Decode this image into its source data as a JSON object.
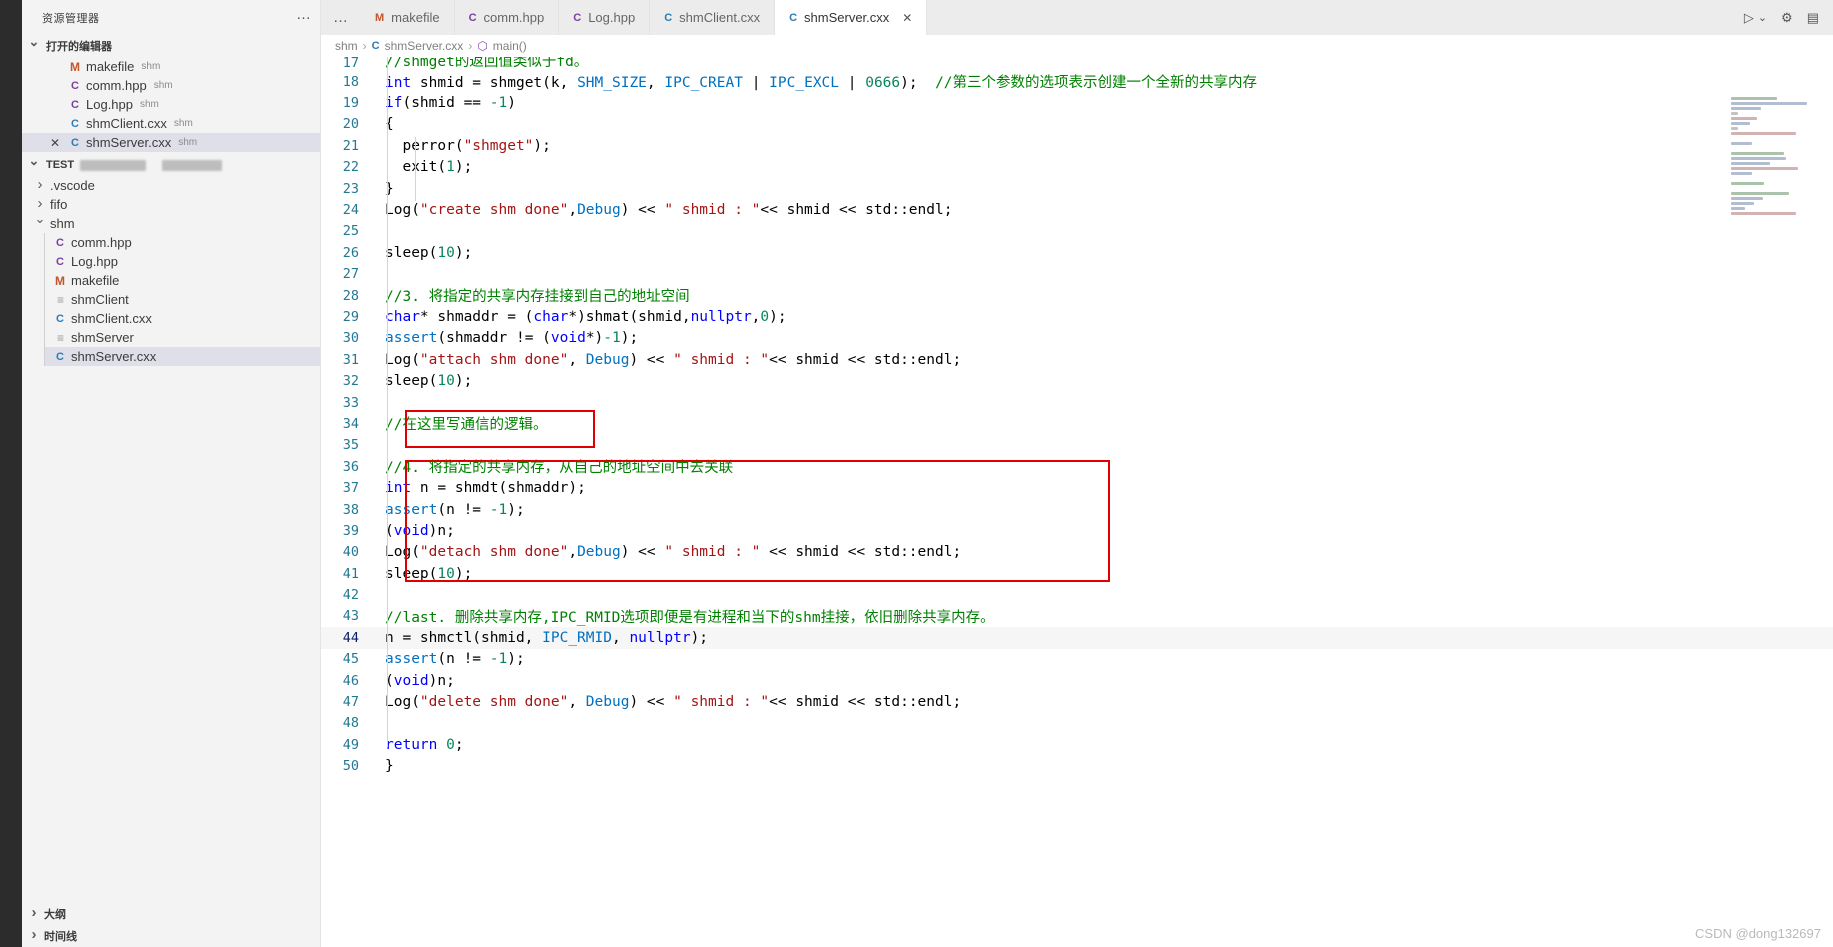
{
  "sidebar": {
    "title": "资源管理器",
    "more_label": "…",
    "open_editors": {
      "label": "打开的编辑器",
      "items": [
        {
          "name": "makefile",
          "desc": "shm",
          "icon": "makefile-icon",
          "icon_glyph": "M",
          "closable": false,
          "selected": false
        },
        {
          "name": "comm.hpp",
          "desc": "shm",
          "icon": "cpp-header-icon",
          "icon_glyph": "C",
          "closable": false,
          "selected": false
        },
        {
          "name": "Log.hpp",
          "desc": "shm",
          "icon": "cpp-header-icon",
          "icon_glyph": "C",
          "closable": false,
          "selected": false
        },
        {
          "name": "shmClient.cxx",
          "desc": "shm",
          "icon": "cpp-source-icon",
          "icon_glyph": "C",
          "closable": false,
          "selected": false
        },
        {
          "name": "shmServer.cxx",
          "desc": "shm",
          "icon": "cpp-source-icon",
          "icon_glyph": "C",
          "closable": true,
          "selected": true
        }
      ]
    },
    "workspace": {
      "label": "TEST",
      "folders": [
        {
          "name": ".vscode",
          "expanded": false
        },
        {
          "name": "fifo",
          "expanded": false
        },
        {
          "name": "shm",
          "expanded": true
        }
      ],
      "shm_files": [
        {
          "name": "comm.hpp",
          "icon_glyph": "C",
          "kind": "hpp"
        },
        {
          "name": "Log.hpp",
          "icon_glyph": "C",
          "kind": "hpp"
        },
        {
          "name": "makefile",
          "icon_glyph": "M",
          "kind": "make"
        },
        {
          "name": "shmClient",
          "icon_glyph": "≡",
          "kind": "bin"
        },
        {
          "name": "shmClient.cxx",
          "icon_glyph": "C",
          "kind": "cxx"
        },
        {
          "name": "shmServer",
          "icon_glyph": "≡",
          "kind": "bin"
        },
        {
          "name": "shmServer.cxx",
          "icon_glyph": "C",
          "kind": "cxx",
          "selected": true
        }
      ]
    },
    "outline_label": "大纲",
    "timeline_label": "时间线"
  },
  "tabs": [
    {
      "label": "makefile",
      "icon_glyph": "M",
      "kind": "make",
      "active": false,
      "closable": false
    },
    {
      "label": "comm.hpp",
      "icon_glyph": "C",
      "kind": "hpp",
      "active": false,
      "closable": false
    },
    {
      "label": "Log.hpp",
      "icon_glyph": "C",
      "kind": "hpp",
      "active": false,
      "closable": false
    },
    {
      "label": "shmClient.cxx",
      "icon_glyph": "C",
      "kind": "cxx",
      "active": false,
      "closable": false
    },
    {
      "label": "shmServer.cxx",
      "icon_glyph": "C",
      "kind": "cxx",
      "active": true,
      "closable": true
    }
  ],
  "tabbar_actions": {
    "run_label": "▷",
    "run_chevron": "⌄",
    "settings_label": "⚙",
    "layout_label": "▤"
  },
  "breadcrumb": {
    "folder": "shm",
    "file": "shmServer.cxx",
    "symbol": "main()",
    "separator": "›"
  },
  "editor": {
    "first_line": 17,
    "lines": [
      {
        "n": 17,
        "text": "//shmget的返回值类似于fd。",
        "clipped": true
      },
      {
        "n": 18,
        "text": "int shmid = shmget(k, SHM_SIZE, IPC_CREAT | IPC_EXCL | 0666);  //第三个参数的选项表示创建一个全新的共享内存"
      },
      {
        "n": 19,
        "text": "if(shmid == -1)"
      },
      {
        "n": 20,
        "text": "{"
      },
      {
        "n": 21,
        "text": "  perror(\"shmget\");"
      },
      {
        "n": 22,
        "text": "  exit(1);"
      },
      {
        "n": 23,
        "text": "}"
      },
      {
        "n": 24,
        "text": "Log(\"create shm done\",Debug) << \" shmid : \"<< shmid << std::endl;"
      },
      {
        "n": 25,
        "text": ""
      },
      {
        "n": 26,
        "text": "sleep(10);"
      },
      {
        "n": 27,
        "text": ""
      },
      {
        "n": 28,
        "text": "//3. 将指定的共享内存挂接到自己的地址空间"
      },
      {
        "n": 29,
        "text": "char* shmaddr = (char*)shmat(shmid,nullptr,0);"
      },
      {
        "n": 30,
        "text": "assert(shmaddr != (void*)-1);"
      },
      {
        "n": 31,
        "text": "Log(\"attach shm done\", Debug) << \" shmid : \"<< shmid << std::endl;"
      },
      {
        "n": 32,
        "text": "sleep(10);"
      },
      {
        "n": 33,
        "text": ""
      },
      {
        "n": 34,
        "text": "//在这里写通信的逻辑。"
      },
      {
        "n": 35,
        "text": ""
      },
      {
        "n": 36,
        "text": "//4. 将指定的共享内存，从自己的地址空间中去关联"
      },
      {
        "n": 37,
        "text": "int n = shmdt(shmaddr);"
      },
      {
        "n": 38,
        "text": "assert(n != -1);"
      },
      {
        "n": 39,
        "text": "(void)n;"
      },
      {
        "n": 40,
        "text": "Log(\"detach shm done\",Debug) << \" shmid : \" << shmid << std::endl;"
      },
      {
        "n": 41,
        "text": "sleep(10);"
      },
      {
        "n": 42,
        "text": ""
      },
      {
        "n": 43,
        "text": "//last. 删除共享内存,IPC_RMID选项即便是有进程和当下的shm挂接，依旧删除共享内存。"
      },
      {
        "n": 44,
        "text": "n = shmctl(shmid, IPC_RMID, nullptr);",
        "highlighted": true
      },
      {
        "n": 45,
        "text": "assert(n != -1);"
      },
      {
        "n": 46,
        "text": "(void)n;"
      },
      {
        "n": 47,
        "text": "Log(\"delete shm done\", Debug) << \" shmid : \"<< shmid << std::endl;"
      },
      {
        "n": 48,
        "text": ""
      },
      {
        "n": 49,
        "text": "return 0;"
      },
      {
        "n": 50,
        "text": "}"
      }
    ],
    "annotations": [
      {
        "name": "red-box-communication-logic",
        "lines": "34"
      },
      {
        "name": "red-box-detach-block",
        "lines": "36-41"
      }
    ]
  },
  "colors": {
    "annotation_red": "#e00000",
    "keyword_blue": "#0000ff",
    "comment_green": "#008000",
    "string_red": "#a31515",
    "number_green": "#098658",
    "macro_blue": "#0070c1",
    "cast_teal": "#267f99",
    "linenum_blue": "#237893",
    "selection_lavender": "#dfdfea"
  },
  "watermark": "CSDN @dong132697"
}
